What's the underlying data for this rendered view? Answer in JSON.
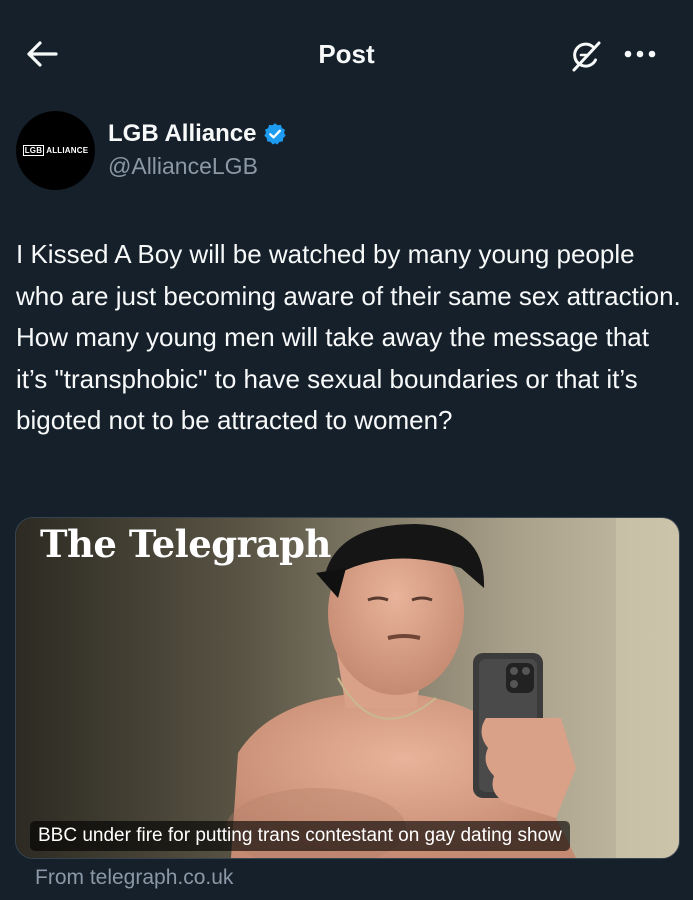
{
  "header": {
    "title": "Post",
    "back_icon": "arrow-left-icon",
    "grok_icon": "grok-icon",
    "more_icon": "more-horizontal-icon"
  },
  "author": {
    "name": "LGB Alliance",
    "handle": "@AllianceLGB",
    "avatar_logo_box": "LGB",
    "avatar_logo_text": "ALLIANCE",
    "verified": true,
    "verified_color": "#1d9bf0"
  },
  "post": {
    "text": "I Kissed A Boy will be watched by many young people who are just becoming aware of their same sex attraction. How many young men will take away the message that it’s \"transphobic\" to have sexual boundaries or that it’s bigoted not to be attracted to women?"
  },
  "link_card": {
    "publisher_logo": "The Telegraph",
    "headline": "BBC under fire for putting trans contestant on gay dating show",
    "source": "From telegraph.co.uk"
  },
  "colors": {
    "background": "#15202b",
    "text": "#f7f9f9",
    "secondary_text": "#8b98a5",
    "accent": "#1d9bf0"
  }
}
